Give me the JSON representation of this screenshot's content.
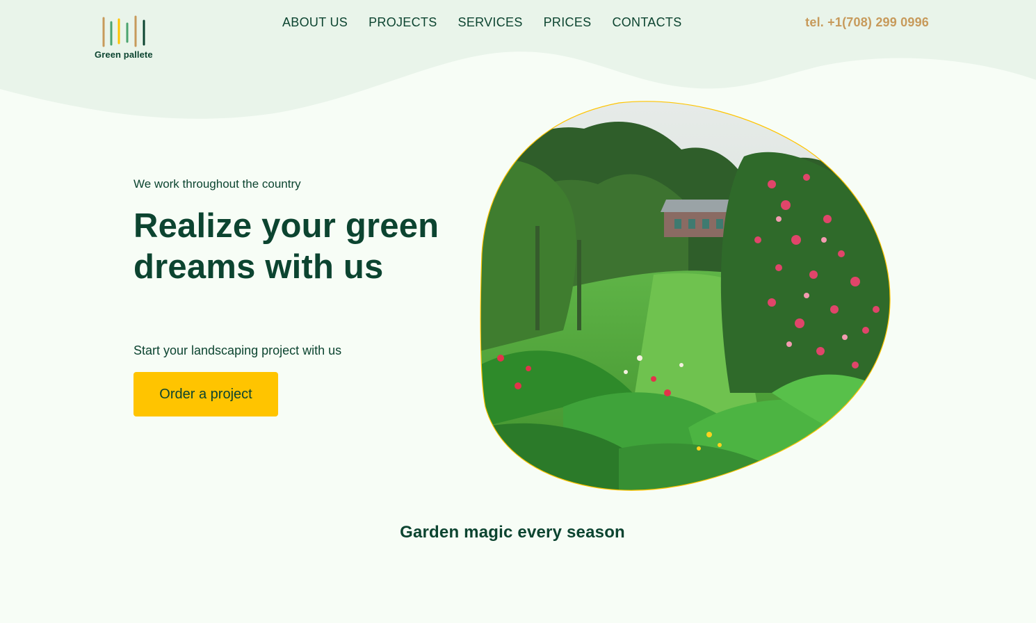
{
  "brand": {
    "name": "Green pallete",
    "colors": {
      "primary_dark_green": "#0c4430",
      "accent_yellow": "#ffc400",
      "accent_tan": "#c79a5b",
      "header_wave": "#e9f4ea",
      "page_background": "#f7fdf6"
    }
  },
  "header": {
    "nav": [
      {
        "label": "ABOUT US"
      },
      {
        "label": "PROJECTS"
      },
      {
        "label": "SERVICES"
      },
      {
        "label": "PRICES"
      },
      {
        "label": "CONTACTS"
      }
    ],
    "phone": "tel. +1(708) 299 0996"
  },
  "hero": {
    "eyebrow": "We work throughout the country",
    "title": "Realize your green dreams with us",
    "subtext": "Start your landscaping project with us",
    "cta_label": "Order a project",
    "image_icon": "garden-photo"
  },
  "section": {
    "title": "Garden magic every season"
  }
}
